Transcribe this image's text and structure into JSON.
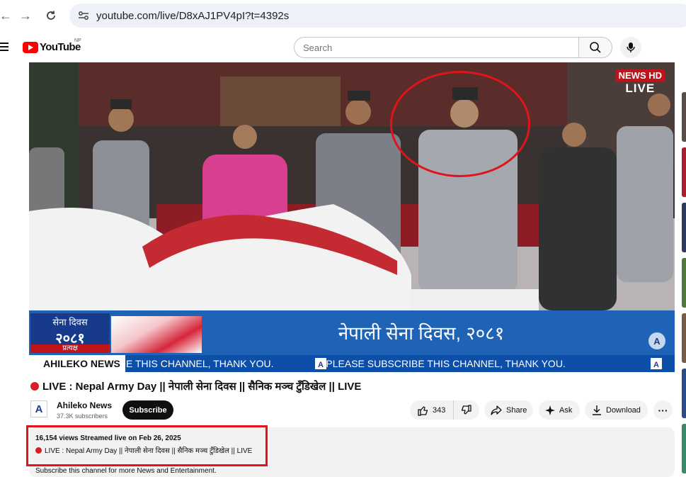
{
  "browser": {
    "url": "youtube.com/live/D8xAJ1PV4pI?t=4392s"
  },
  "header": {
    "logo_text": "YouTube",
    "region": "NP",
    "search_placeholder": "Search"
  },
  "video": {
    "live_brand": "NEWS HD",
    "live_label": "LIVE",
    "lower_third": {
      "date_line1": "सेना दिवस",
      "date_line2": "२०८१",
      "date_line3": "प्रत्यक्ष",
      "title": "नेपाली सेना दिवस, २०८१"
    },
    "ticker": {
      "brand": "AHILEKO NEWS",
      "messages": [
        "E THIS CHANNEL, THANK YOU.",
        "PLEASE SUBSCRIBE THIS CHANNEL, THANK YOU."
      ]
    }
  },
  "title": "LIVE : Nepal Army Day || नेपाली सेना दिवस || सैनिक मञ्च टुँडिखेल || LIVE",
  "channel": {
    "name": "Ahileko News",
    "subscribers": "37.3K subscribers",
    "subscribe_label": "Subscribe"
  },
  "actions": {
    "likes": "343",
    "share_label": "Share",
    "ask_label": "Ask",
    "download_label": "Download"
  },
  "description": {
    "stats": "16,154 views  Streamed live on Feb 26, 2025",
    "title": "LIVE : Nepal Army Day || नेपाली सेना दिवस || सैनिक मञ्च टुँडिखेल || LIVE",
    "extra": "Subscribe this channel for more News and Entertainment."
  },
  "colors": {
    "accent_red": "#e0141c",
    "youtube_red": "#ff0000",
    "lower_third_blue": "#1f63b7"
  }
}
